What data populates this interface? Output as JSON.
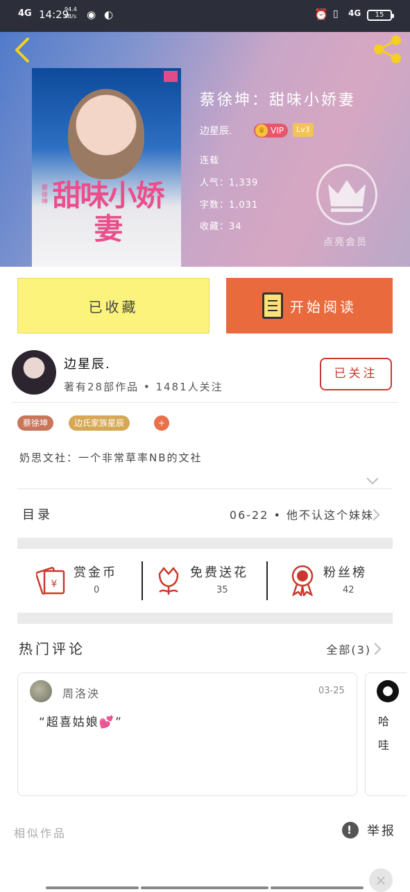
{
  "status_bar": {
    "network": "4G",
    "time": "14:29",
    "speed_value": "94.4",
    "speed_unit": "kB/s",
    "right_network": "4G",
    "battery": "15"
  },
  "book": {
    "title": "蔡徐坤：甜味小娇妻",
    "cover_title": "甜味小娇妻",
    "cover_tag": "蔡徐坤",
    "author": "边星辰.",
    "vip_label": "VIP",
    "level_label": "Lv3",
    "status": "连载",
    "popularity": "人气：1,339",
    "word_count": "字数：1,031",
    "favorites": "收藏：34",
    "member_label": "点亮会员"
  },
  "actions": {
    "favorited_label": "已收藏",
    "read_label": "开始阅读"
  },
  "author": {
    "name": "边星辰.",
    "stats": "著有28部作品 • 1481人关注",
    "follow_label": "已关注"
  },
  "tags": [
    "蔡徐坤",
    "边氏家族星辰"
  ],
  "tag_add": "+",
  "description": "奶思文社：一个非常草率NB的文社",
  "toc": {
    "label": "目录",
    "latest": "06-22 • 他不认这个妹妹"
  },
  "stats": [
    {
      "label": "赏金币",
      "value": "0",
      "icon": "red-envelope-icon"
    },
    {
      "label": "免费送花",
      "value": "35",
      "icon": "flower-icon"
    },
    {
      "label": "粉丝榜",
      "value": "42",
      "icon": "medal-icon"
    }
  ],
  "comments": {
    "title": "热门评论",
    "all_label": "全部(3)",
    "items": [
      {
        "user": "周洛泱",
        "date": "03-25",
        "text": "“超喜姑娘💕”"
      },
      {
        "text_line1": "哈",
        "text_line2": "哇"
      }
    ]
  },
  "footer": {
    "similar_label": "相似作品",
    "report_label": "举报",
    "close_label": "×"
  },
  "colors": {
    "read_button": "#e96a3c",
    "fav_button": "#fbf37c",
    "follow_border": "#c6392e"
  }
}
